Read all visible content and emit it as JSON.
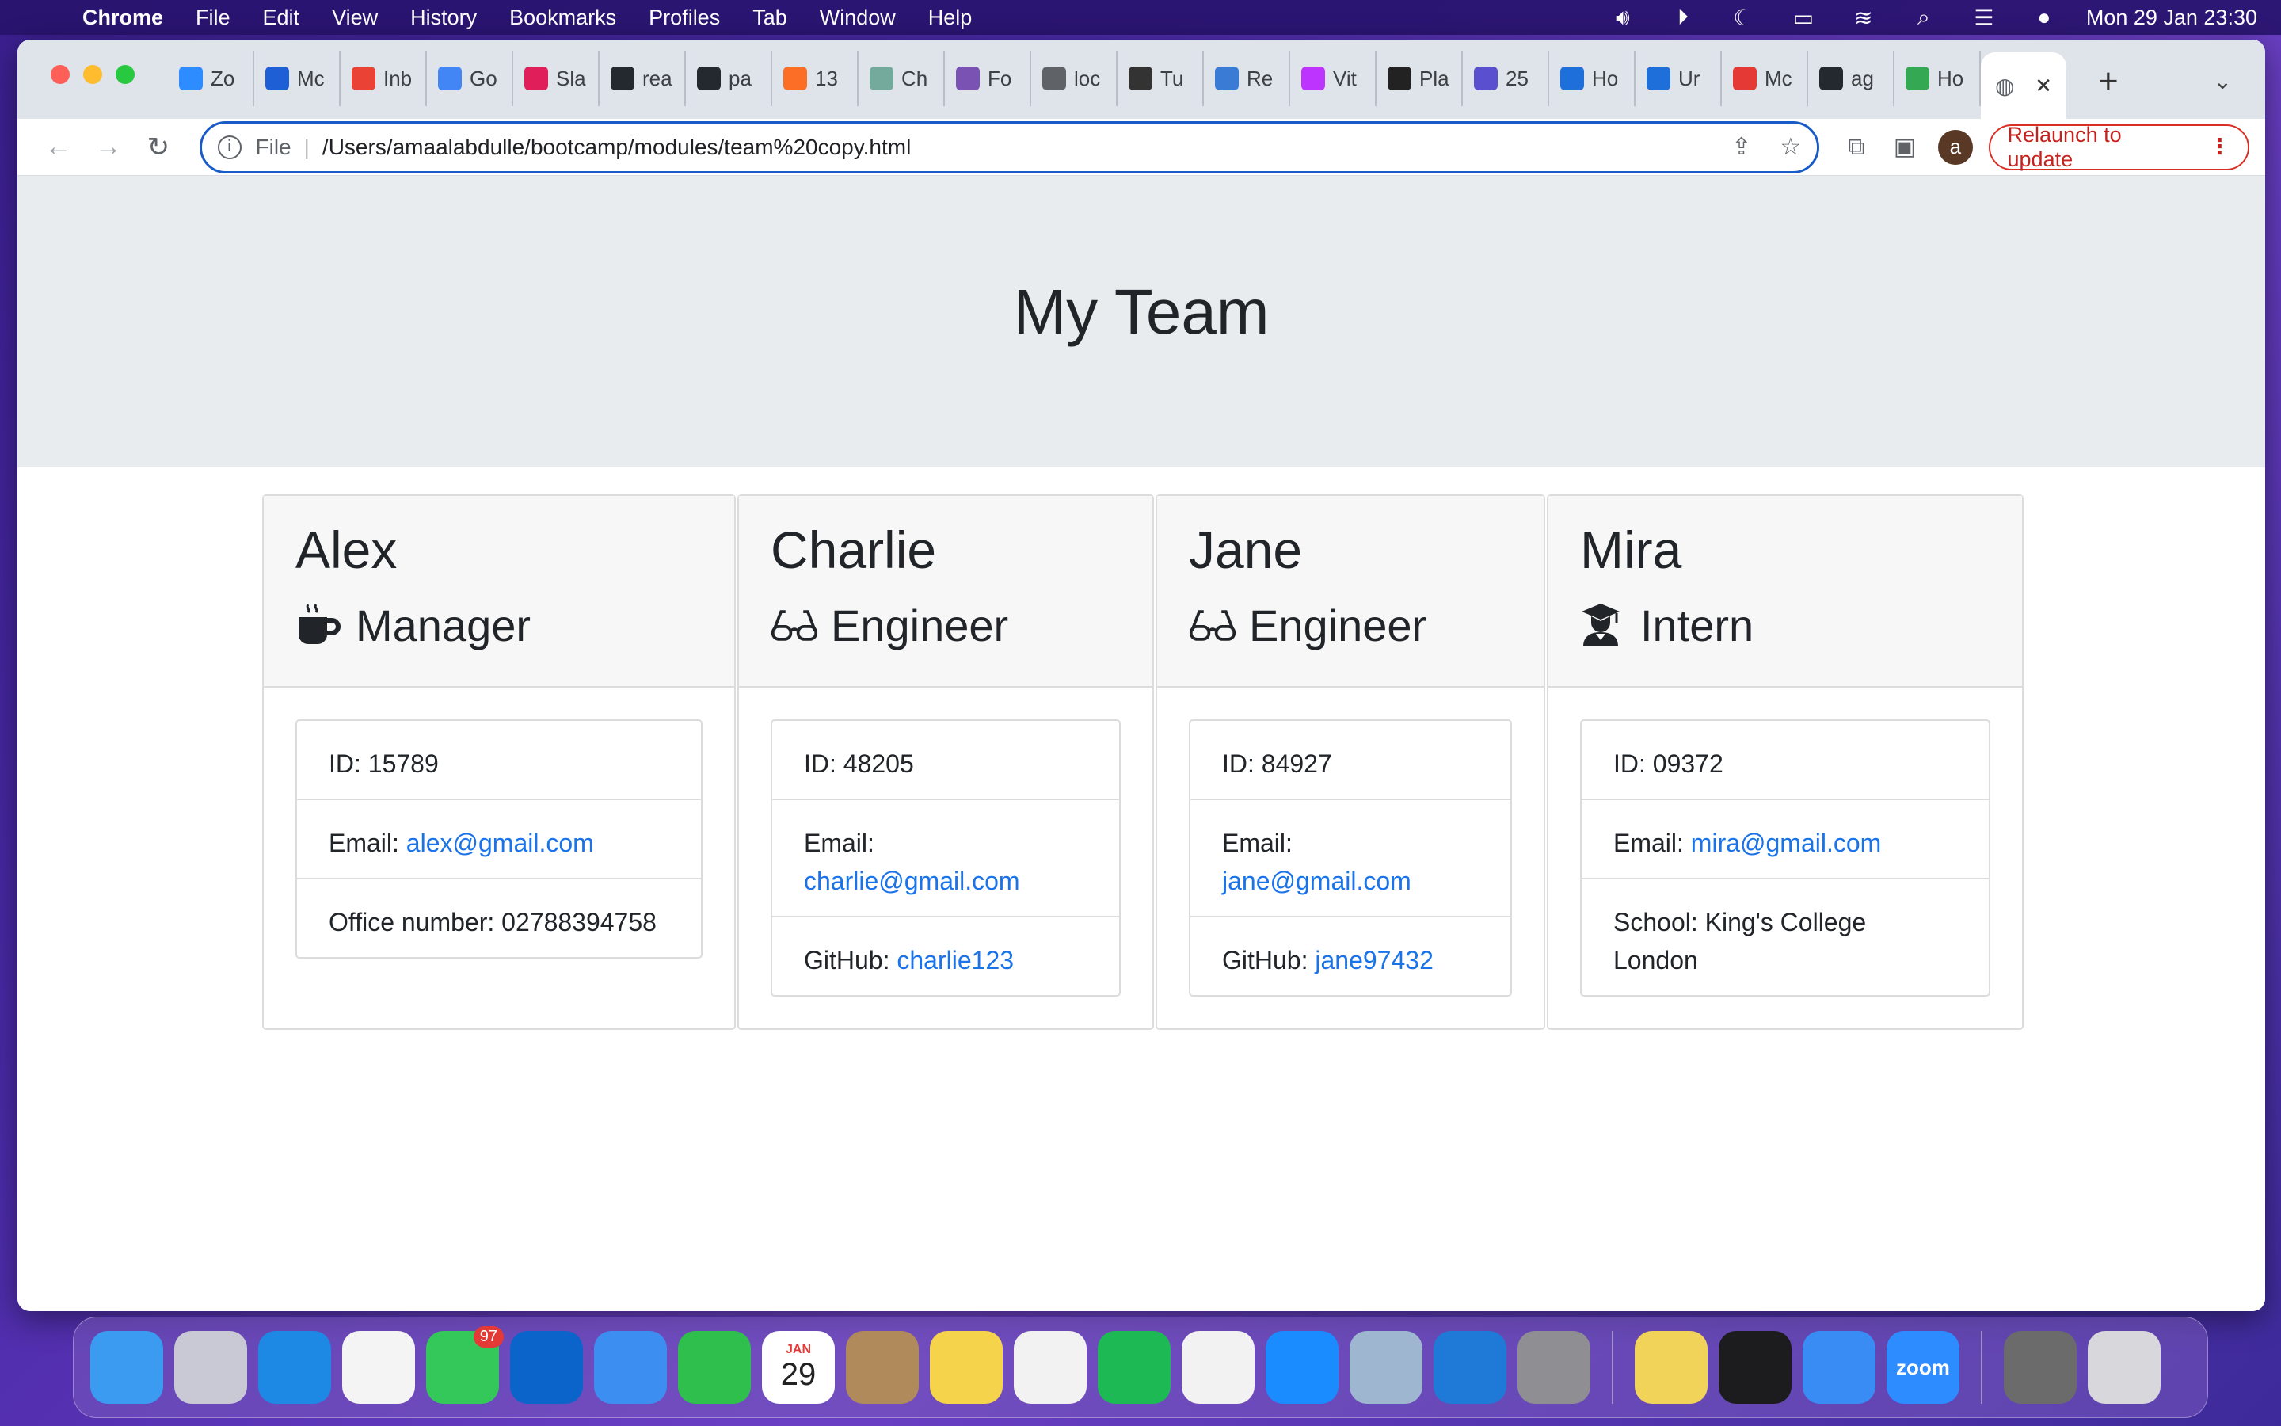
{
  "menubar": {
    "app": "Chrome",
    "items": [
      "File",
      "Edit",
      "View",
      "History",
      "Bookmarks",
      "Profiles",
      "Tab",
      "Window",
      "Help"
    ],
    "clock": "Mon 29 Jan  23:30"
  },
  "browser": {
    "tabs": [
      {
        "label": "Zo",
        "icon": "zoom-icon",
        "color": "#2d8cff"
      },
      {
        "label": "Mc",
        "icon": "zm-icon",
        "color": "#1f5fd6"
      },
      {
        "label": "Inb",
        "icon": "gmail-icon",
        "color": "#ea4335"
      },
      {
        "label": "Go",
        "icon": "calendar-icon",
        "color": "#4285f4"
      },
      {
        "label": "Sla",
        "icon": "slack-icon",
        "color": "#e01e5a"
      },
      {
        "label": "rea",
        "icon": "github-icon",
        "color": "#24292f"
      },
      {
        "label": "pa",
        "icon": "github-icon",
        "color": "#24292f"
      },
      {
        "label": "13",
        "icon": "gitlab-icon",
        "color": "#fc6d26"
      },
      {
        "label": "Ch",
        "icon": "chatgpt-icon",
        "color": "#74aa9c"
      },
      {
        "label": "Fo",
        "icon": "bootstrap-icon",
        "color": "#7952b3"
      },
      {
        "label": "loc",
        "icon": "globe-icon",
        "color": "#5f6368"
      },
      {
        "label": "Tu",
        "icon": "tutorial-icon",
        "color": "#333333"
      },
      {
        "label": "Re",
        "icon": "react-icon",
        "color": "#3a7bd5"
      },
      {
        "label": "Vit",
        "icon": "vite-icon",
        "color": "#bd34fe"
      },
      {
        "label": "Pla",
        "icon": "square-icon",
        "color": "#222222"
      },
      {
        "label": "25",
        "icon": "h-icon",
        "color": "#5a4fcf"
      },
      {
        "label": "Ho",
        "icon": "e-icon",
        "color": "#1e6fd9"
      },
      {
        "label": "Ur",
        "icon": "e-icon",
        "color": "#1e6fd9"
      },
      {
        "label": "Mc",
        "icon": "red-square-icon",
        "color": "#e53935"
      },
      {
        "label": "ag",
        "icon": "github-icon",
        "color": "#24292f"
      },
      {
        "label": "Ho",
        "icon": "drive-icon",
        "color": "#34a853"
      }
    ],
    "url_scheme": "File",
    "url": "/Users/amaalabdulle/bootcamp/modules/team%20copy.html",
    "avatar_letter": "a",
    "relaunch_label": "Relaunch to update"
  },
  "page": {
    "title": "My Team",
    "members": [
      {
        "name": "Alex",
        "role": "Manager",
        "role_icon": "coffee-mug-icon",
        "id_text": "ID: 15789",
        "email_label": "Email: ",
        "email": "alex@gmail.com",
        "extra_label": "Office number: 02788394758",
        "extra_link": ""
      },
      {
        "name": "Charlie",
        "role": "Engineer",
        "role_icon": "glasses-icon",
        "id_text": "ID: 48205",
        "email_label": "Email: ",
        "email": "charlie@gmail.com",
        "extra_label": "GitHub: ",
        "extra_link": "charlie123"
      },
      {
        "name": "Jane",
        "role": "Engineer",
        "role_icon": "glasses-icon",
        "id_text": "ID: 84927",
        "email_label": "Email: ",
        "email": "jane@gmail.com",
        "extra_label": "GitHub: ",
        "extra_link": "jane97432"
      },
      {
        "name": "Mira",
        "role": "Intern",
        "role_icon": "graduate-icon",
        "id_text": "ID: 09372",
        "email_label": "Email: ",
        "email": "mira@gmail.com",
        "extra_label": "School: King's College London",
        "extra_link": ""
      }
    ]
  },
  "dock": {
    "apps": [
      {
        "name": "finder-icon",
        "color": "#3a9bf0"
      },
      {
        "name": "launchpad-icon",
        "color": "#c9c9d6"
      },
      {
        "name": "safari-icon",
        "color": "#1e88e5"
      },
      {
        "name": "chrome-icon",
        "color": "#f4f4f4"
      },
      {
        "name": "messages-icon",
        "color": "#34c759",
        "badge": "97"
      },
      {
        "name": "outlook-icon",
        "color": "#0a64c9"
      },
      {
        "name": "mail-icon",
        "color": "#3c8ff0"
      },
      {
        "name": "facetime-icon",
        "color": "#2fbf4d"
      },
      {
        "name": "calendar-icon",
        "color": "#ffffff",
        "label_top": "JAN",
        "label": "29"
      },
      {
        "name": "contacts-icon",
        "color": "#b08a5a"
      },
      {
        "name": "notes-icon",
        "color": "#f5d34a"
      },
      {
        "name": "freeform-icon",
        "color": "#f2f2f2"
      },
      {
        "name": "spotify-icon",
        "color": "#1db954"
      },
      {
        "name": "news-icon",
        "color": "#f2f2f2"
      },
      {
        "name": "appstore-icon",
        "color": "#1a8cff"
      },
      {
        "name": "preview-icon",
        "color": "#9fb6d0"
      },
      {
        "name": "vscode-icon",
        "color": "#1e7ad6"
      },
      {
        "name": "system-settings-icon",
        "color": "#8e8e93"
      },
      {
        "name": "stickies-icon",
        "color": "#f1d35a"
      },
      {
        "name": "terminal-icon",
        "color": "#1c1c1e"
      },
      {
        "name": "xcode-icon",
        "color": "#3a8cf5"
      },
      {
        "name": "zoom-icon",
        "color": "#2d8cff",
        "label": "zoom"
      },
      {
        "name": "downloads-stack-icon",
        "color": "#6b6b6b"
      },
      {
        "name": "trash-icon",
        "color": "#d8d8dc"
      }
    ]
  }
}
